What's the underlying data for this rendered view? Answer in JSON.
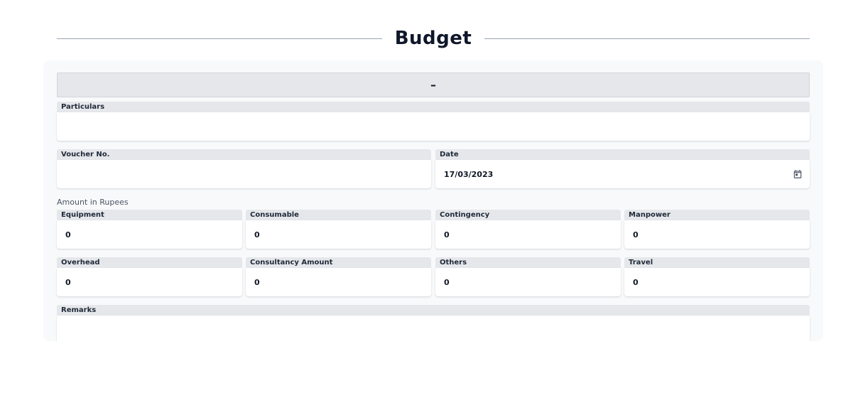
{
  "page": {
    "title": "Budget"
  },
  "collapse_button": {
    "symbol": "–"
  },
  "fields": {
    "particulars": {
      "label": "Particulars",
      "value": ""
    },
    "voucher_no": {
      "label": "Voucher No.",
      "value": ""
    },
    "date": {
      "label": "Date",
      "value": "17/03/2023"
    },
    "section_amount": "Amount in Rupees",
    "equipment": {
      "label": "Equipment",
      "value": "0"
    },
    "consumable": {
      "label": "Consumable",
      "value": "0"
    },
    "contingency": {
      "label": "Contingency",
      "value": "0"
    },
    "manpower": {
      "label": "Manpower",
      "value": "0"
    },
    "overhead": {
      "label": "Overhead",
      "value": "0"
    },
    "consultancy_amount": {
      "label": "Consultancy Amount",
      "value": "0"
    },
    "others": {
      "label": "Others",
      "value": "0"
    },
    "travel": {
      "label": "Travel",
      "value": "0"
    },
    "remarks": {
      "label": "Remarks",
      "value": ""
    }
  },
  "icons": {
    "date_picker": "calendar-icon"
  }
}
